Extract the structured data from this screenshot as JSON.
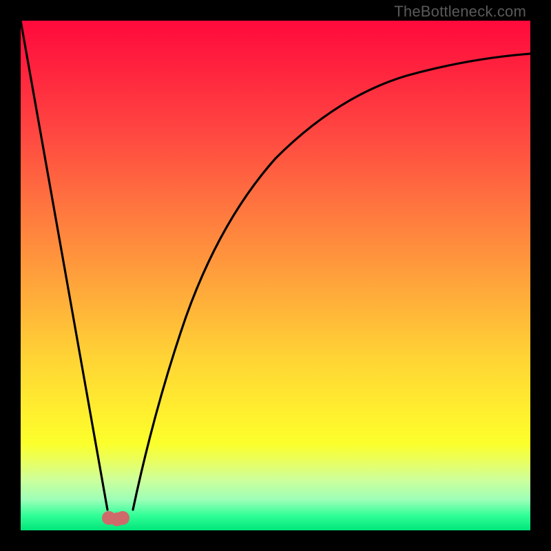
{
  "watermark": {
    "text": "TheBottleneck.com"
  },
  "colors": {
    "frame": "#000000",
    "curve_stroke": "#000000",
    "marker_fill": "#cf6a6a",
    "gradient_top": "#ff0a3c",
    "gradient_bottom": "#00e67a"
  },
  "chart_data": {
    "type": "line",
    "title": "",
    "xlabel": "",
    "ylabel": "",
    "xlim": [
      0,
      100
    ],
    "ylim": [
      0,
      100
    ],
    "note": "Axes are unlabeled; values are read off relative pixel positions (0–100 normalized). y=0 is bottom (green/good), y=100 is top (red/bad).",
    "series": [
      {
        "name": "left-line",
        "type": "line",
        "x": [
          0,
          17
        ],
        "y": [
          100,
          4
        ]
      },
      {
        "name": "right-curve",
        "type": "line",
        "x": [
          22,
          25,
          30,
          35,
          40,
          45,
          50,
          55,
          60,
          65,
          70,
          75,
          80,
          85,
          90,
          95,
          100
        ],
        "y": [
          4,
          14,
          30,
          44,
          55,
          63,
          70,
          75,
          79,
          82,
          84.5,
          86.5,
          88,
          89,
          90,
          90.8,
          91.5
        ]
      }
    ],
    "markers": [
      {
        "name": "optimum-marker",
        "x": 19,
        "y": 3,
        "shape": "blob",
        "color": "#cf6a6a"
      }
    ]
  }
}
